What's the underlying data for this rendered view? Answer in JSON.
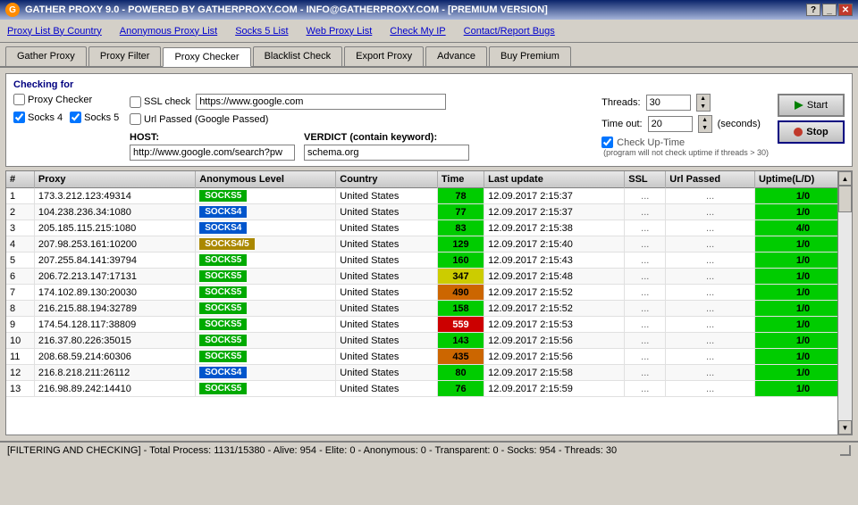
{
  "titlebar": {
    "title": "GATHER PROXY 9.0 - POWERED BY GATHERPROXY.COM - INFO@GATHERPROXY.COM - [PREMIUM VERSION]",
    "logo": "G"
  },
  "menubar": {
    "items": [
      {
        "id": "proxy-list-country",
        "label": "Proxy List By Country"
      },
      {
        "id": "anonymous-proxy-list",
        "label": "Anonymous Proxy List"
      },
      {
        "id": "socks5-list",
        "label": "Socks 5 List"
      },
      {
        "id": "web-proxy-list",
        "label": "Web Proxy List"
      },
      {
        "id": "check-my-ip",
        "label": "Check My IP"
      },
      {
        "id": "contact-report-bugs",
        "label": "Contact/Report Bugs"
      }
    ]
  },
  "tabs": [
    {
      "id": "gather-proxy",
      "label": "Gather Proxy",
      "active": false
    },
    {
      "id": "proxy-filter",
      "label": "Proxy Filter",
      "active": false
    },
    {
      "id": "proxy-checker",
      "label": "Proxy Checker",
      "active": true
    },
    {
      "id": "blacklist-check",
      "label": "Blacklist Check",
      "active": false
    },
    {
      "id": "export-proxy",
      "label": "Export Proxy",
      "active": false
    },
    {
      "id": "advance",
      "label": "Advance",
      "active": false
    },
    {
      "id": "buy-premium",
      "label": "Buy Premium",
      "active": false
    }
  ],
  "checking": {
    "section_label": "Checking for",
    "proxy_checker_label": "Proxy Checker",
    "socks4_label": "Socks 4",
    "socks5_label": "Socks 5",
    "ssl_check_label": "SSL check",
    "ssl_url": "https://www.google.com",
    "url_passed_label": "Url Passed (Google Passed)",
    "threads_label": "Threads:",
    "threads_value": "30",
    "timeout_label": "Time out:",
    "timeout_value": "20",
    "seconds_label": "(seconds)",
    "check_uptime_label": "Check Up-Time",
    "uptime_note": "(program will not check uptime if threads > 30)",
    "host_label": "HOST:",
    "host_value": "http://www.google.com/search?pw",
    "verdict_label": "VERDICT (contain keyword):",
    "verdict_value": "schema.org",
    "start_label": "Start",
    "stop_label": "Stop"
  },
  "table": {
    "columns": [
      "#",
      "Proxy",
      "Anonymous Level",
      "Country",
      "Time",
      "Last update",
      "SSL",
      "Url Passed",
      "Uptime(L/D)"
    ],
    "rows": [
      {
        "num": 1,
        "proxy": "173.3.212.123:49314",
        "anon": "SOCKS5",
        "anon_type": "socks5",
        "country": "United States",
        "time": 78,
        "time_class": "time-fast",
        "last_update": "12.09.2017 2:15:37",
        "ssl": "...",
        "url_passed": "...",
        "uptime": "1/0"
      },
      {
        "num": 2,
        "proxy": "104.238.236.34:1080",
        "anon": "SOCKS4",
        "anon_type": "socks4",
        "country": "United States",
        "time": 77,
        "time_class": "time-fast",
        "last_update": "12.09.2017 2:15:37",
        "ssl": "...",
        "url_passed": "...",
        "uptime": "1/0"
      },
      {
        "num": 3,
        "proxy": "205.185.115.215:1080",
        "anon": "SOCKS4",
        "anon_type": "socks4",
        "country": "United States",
        "time": 83,
        "time_class": "time-fast",
        "last_update": "12.09.2017 2:15:38",
        "ssl": "...",
        "url_passed": "...",
        "uptime": "4/0"
      },
      {
        "num": 4,
        "proxy": "207.98.253.161:10200",
        "anon": "SOCKS4/5",
        "anon_type": "socks45",
        "country": "United States",
        "time": 129,
        "time_class": "time-fast",
        "last_update": "12.09.2017 2:15:40",
        "ssl": "...",
        "url_passed": "...",
        "uptime": "1/0"
      },
      {
        "num": 5,
        "proxy": "207.255.84.141:39794",
        "anon": "SOCKS5",
        "anon_type": "socks5",
        "country": "United States",
        "time": 160,
        "time_class": "time-fast",
        "last_update": "12.09.2017 2:15:43",
        "ssl": "...",
        "url_passed": "...",
        "uptime": "1/0"
      },
      {
        "num": 6,
        "proxy": "206.72.213.147:17131",
        "anon": "SOCKS5",
        "anon_type": "socks5",
        "country": "United States",
        "time": 347,
        "time_class": "time-medium",
        "last_update": "12.09.2017 2:15:48",
        "ssl": "...",
        "url_passed": "...",
        "uptime": "1/0"
      },
      {
        "num": 7,
        "proxy": "174.102.89.130:20030",
        "anon": "SOCKS5",
        "anon_type": "socks5",
        "country": "United States",
        "time": 490,
        "time_class": "time-slow",
        "last_update": "12.09.2017 2:15:52",
        "ssl": "...",
        "url_passed": "...",
        "uptime": "1/0"
      },
      {
        "num": 8,
        "proxy": "216.215.88.194:32789",
        "anon": "SOCKS5",
        "anon_type": "socks5",
        "country": "United States",
        "time": 158,
        "time_class": "time-fast",
        "last_update": "12.09.2017 2:15:52",
        "ssl": "...",
        "url_passed": "...",
        "uptime": "1/0"
      },
      {
        "num": 9,
        "proxy": "174.54.128.117:38809",
        "anon": "SOCKS5",
        "anon_type": "socks5",
        "country": "United States",
        "time": 559,
        "time_class": "time-vslow",
        "last_update": "12.09.2017 2:15:53",
        "ssl": "...",
        "url_passed": "...",
        "uptime": "1/0"
      },
      {
        "num": 10,
        "proxy": "216.37.80.226:35015",
        "anon": "SOCKS5",
        "anon_type": "socks5",
        "country": "United States",
        "time": 143,
        "time_class": "time-fast",
        "last_update": "12.09.2017 2:15:56",
        "ssl": "...",
        "url_passed": "...",
        "uptime": "1/0"
      },
      {
        "num": 11,
        "proxy": "208.68.59.214:60306",
        "anon": "SOCKS5",
        "anon_type": "socks5",
        "country": "United States",
        "time": 435,
        "time_class": "time-slow",
        "last_update": "12.09.2017 2:15:56",
        "ssl": "...",
        "url_passed": "...",
        "uptime": "1/0"
      },
      {
        "num": 12,
        "proxy": "216.8.218.211:26112",
        "anon": "SOCKS4",
        "anon_type": "socks4",
        "country": "United States",
        "time": 80,
        "time_class": "time-fast",
        "last_update": "12.09.2017 2:15:58",
        "ssl": "...",
        "url_passed": "...",
        "uptime": "1/0"
      },
      {
        "num": 13,
        "proxy": "216.98.89.242:14410",
        "anon": "SOCKS5",
        "anon_type": "socks5",
        "country": "United States",
        "time": 76,
        "time_class": "time-fast",
        "last_update": "12.09.2017 2:15:59",
        "ssl": "...",
        "url_passed": "...",
        "uptime": "1/0"
      }
    ]
  },
  "statusbar": {
    "text": "[FILTERING AND CHECKING] - Total Process: 1131/15380 - Alive: 954 - Elite: 0 - Anonymous: 0 - Transparent: 0 - Socks: 954 - Threads: 30"
  }
}
